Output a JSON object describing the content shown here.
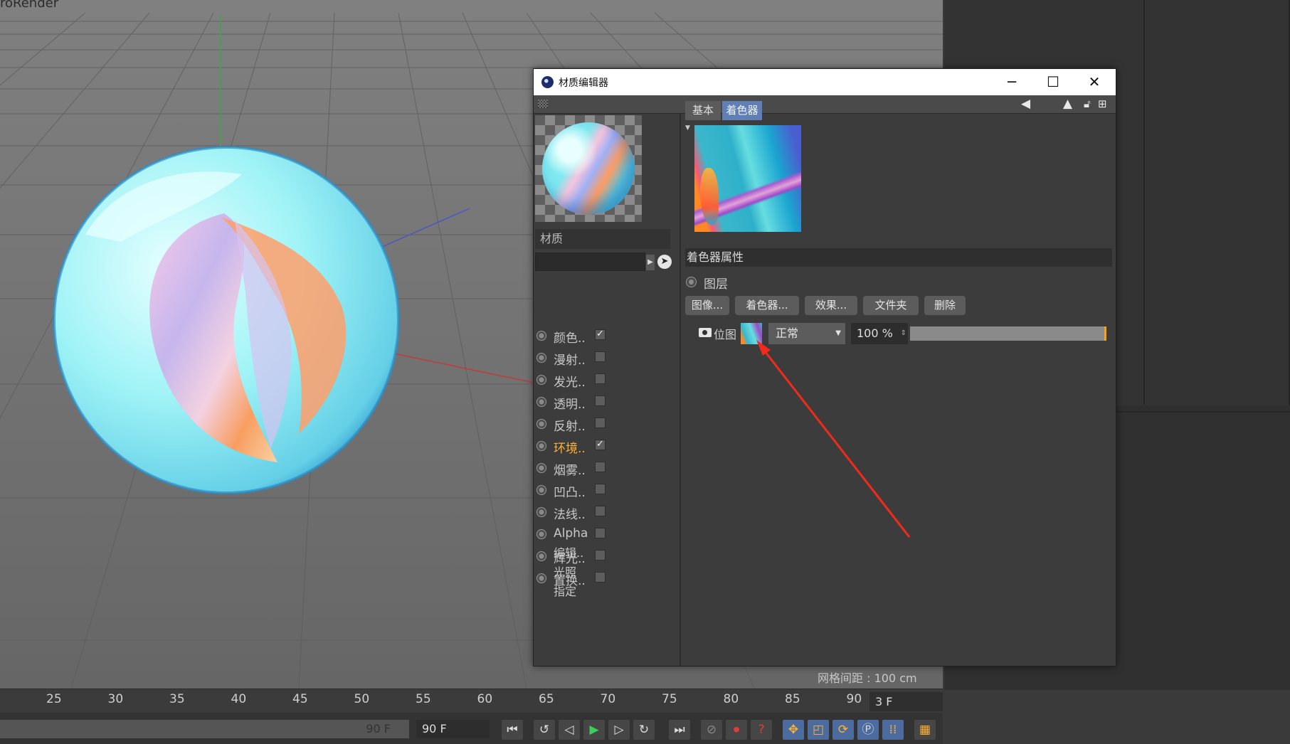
{
  "viewport": {
    "title": "roRender",
    "grid_spacing": "网格间距 : 100 cm"
  },
  "material_editor": {
    "title": "材质编辑器",
    "window_controls": {
      "minimize": "─",
      "maximize": "☐",
      "close": "✕"
    },
    "toolbar_icons": [
      "arrow-left-icon",
      "cursor-icon",
      "lock-icon",
      "new-window-icon"
    ],
    "material_name_placeholder": "材质",
    "channels": [
      {
        "label": "颜色..",
        "checked": true,
        "active": false
      },
      {
        "label": "漫射..",
        "checked": false,
        "active": false
      },
      {
        "label": "发光..",
        "checked": false,
        "active": false
      },
      {
        "label": "透明..",
        "checked": false,
        "active": false
      },
      {
        "label": "反射..",
        "checked": false,
        "active": false
      },
      {
        "label": "环境..",
        "checked": true,
        "active": true
      },
      {
        "label": "烟雾..",
        "checked": false,
        "active": false
      },
      {
        "label": "凹凸..",
        "checked": false,
        "active": false
      },
      {
        "label": "法线..",
        "checked": false,
        "active": false
      },
      {
        "label": "Alpha",
        "checked": false,
        "active": false
      },
      {
        "label": "辉光..",
        "checked": false,
        "active": false
      },
      {
        "label": "置换..",
        "checked": false,
        "active": false
      }
    ],
    "extra_items": [
      "编辑..",
      "光照",
      "指定"
    ],
    "tabs": {
      "basic": "基本",
      "shader": "着色器"
    },
    "shader_properties_header": "着色器属性",
    "layer_label": "图层",
    "buttons": {
      "image": "图像...",
      "shader": "着色器...",
      "effect": "效果...",
      "folder": "文件夹",
      "delete": "删除"
    },
    "layer_row": {
      "label": "位图",
      "blend_mode": "正常",
      "opacity": "100 %",
      "opacity_level": 1.0
    }
  },
  "timeline": {
    "ticks": [
      "25",
      "30",
      "35",
      "40",
      "45",
      "50",
      "55",
      "60",
      "65",
      "70",
      "75",
      "80",
      "85",
      "90"
    ],
    "current_frame": "3 F",
    "range_end_label": "90 F",
    "end_frame": "90 F"
  },
  "transport_icons": [
    "go-start-icon",
    "loop-left-icon",
    "step-back-icon",
    "play-icon",
    "step-forward-icon",
    "loop-right-icon",
    "go-end-icon",
    "keyframe-off-icon",
    "record-icon",
    "help-icon",
    "move-icon",
    "scale-icon",
    "rotate-icon",
    "param-icon",
    "grid-dots-icon",
    "film-icon"
  ]
}
